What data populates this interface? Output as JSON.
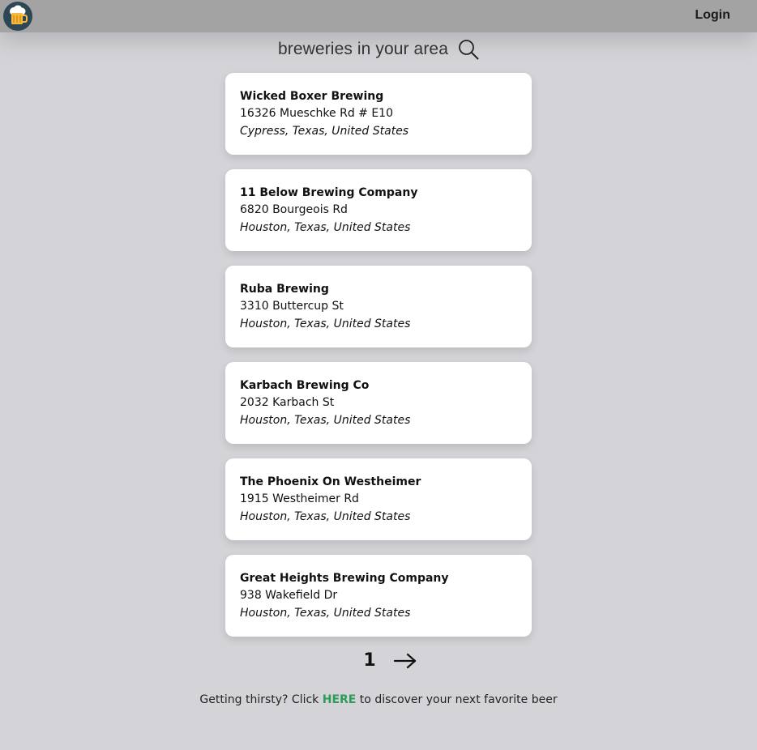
{
  "header": {
    "logo_icon": "beer-mug-icon",
    "login_label": "Login"
  },
  "search": {
    "label": "breweries in your area",
    "icon": "search-icon"
  },
  "breweries": [
    {
      "name": "Wicked Boxer Brewing",
      "street": "16326 Mueschke Rd # E10",
      "location": "Cypress, Texas, United States"
    },
    {
      "name": "11 Below Brewing Company",
      "street": "6820 Bourgeois Rd",
      "location": "Houston, Texas, United States"
    },
    {
      "name": "Ruba Brewing",
      "street": "3310 Buttercup St",
      "location": "Houston, Texas, United States"
    },
    {
      "name": "Karbach Brewing Co",
      "street": "2032 Karbach St",
      "location": "Houston, Texas, United States"
    },
    {
      "name": "The Phoenix On Westheimer",
      "street": "1915 Westheimer Rd",
      "location": "Houston, Texas, United States"
    },
    {
      "name": "Great Heights Brewing Company",
      "street": "938 Wakefield Dr",
      "location": "Houston, Texas, United States"
    }
  ],
  "pagination": {
    "current_page": "1",
    "next_icon": "arrow-right-icon"
  },
  "footer": {
    "prefix": "Getting thirsty? Click ",
    "link": "HERE",
    "suffix": " to discover your next favorite beer"
  },
  "colors": {
    "background": "#d4d4d8",
    "topbar": "#a3a3a3",
    "link": "#2e9b57",
    "logo_bg": "#2e4754"
  }
}
